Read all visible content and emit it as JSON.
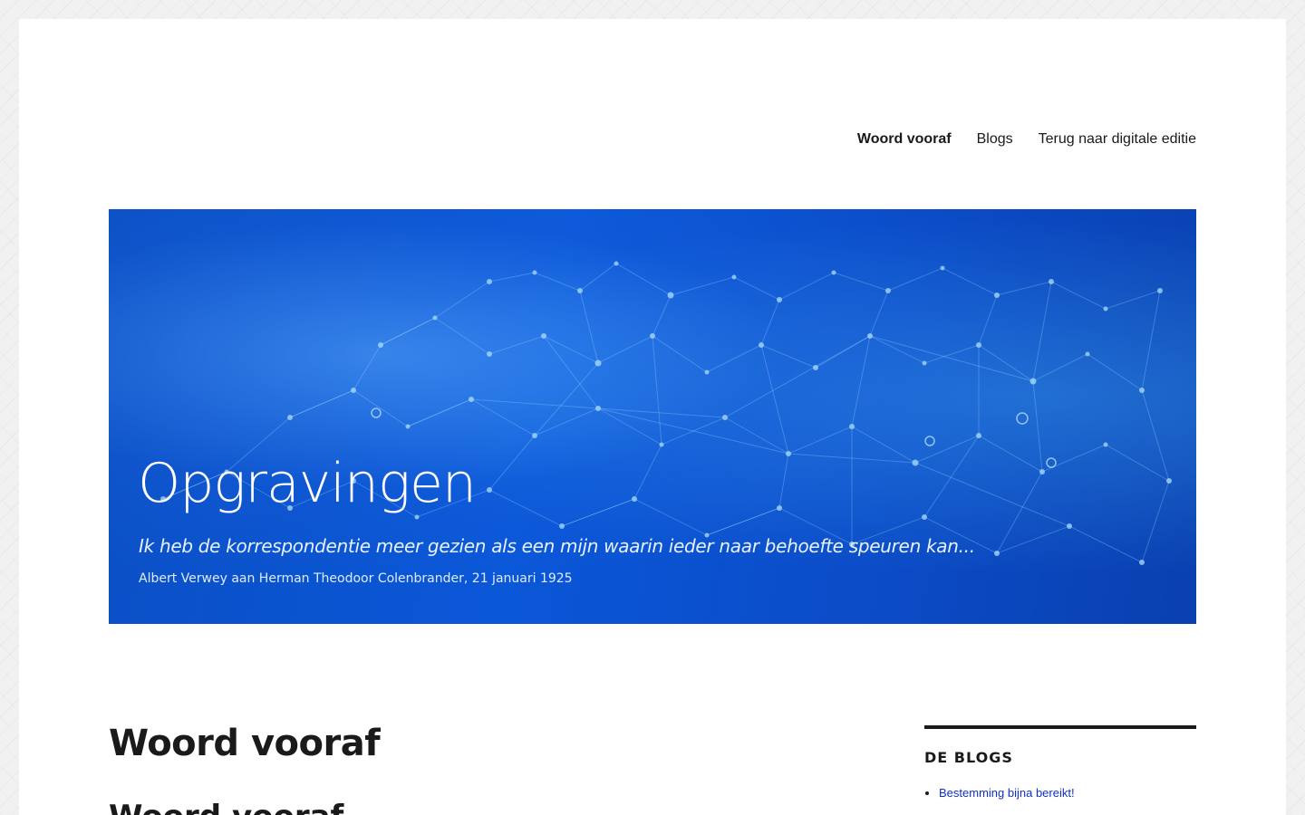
{
  "nav": {
    "items": [
      {
        "label": "Woord vooraf",
        "current": true
      },
      {
        "label": "Blogs",
        "current": false
      },
      {
        "label": "Terug naar digitale editie",
        "current": false
      }
    ]
  },
  "banner": {
    "title": "Opgravingen",
    "quote": "Ik heb de korrespondentie meer gezien als een mijn waarin ieder naar behoefte speuren kan...",
    "attribution": "Albert Verwey aan Herman Theodoor Colenbrander, 21 januari 1925"
  },
  "page": {
    "title": "Woord vooraf",
    "subtitle": "Woord vooraf"
  },
  "sidebar": {
    "widget_title": "De blogs",
    "posts": [
      {
        "label": "Bestemming bijna bereikt!"
      }
    ]
  },
  "colors": {
    "banner_blue": "#0a57d8",
    "link_blue": "#1030c8",
    "text": "#1a1a1a"
  }
}
